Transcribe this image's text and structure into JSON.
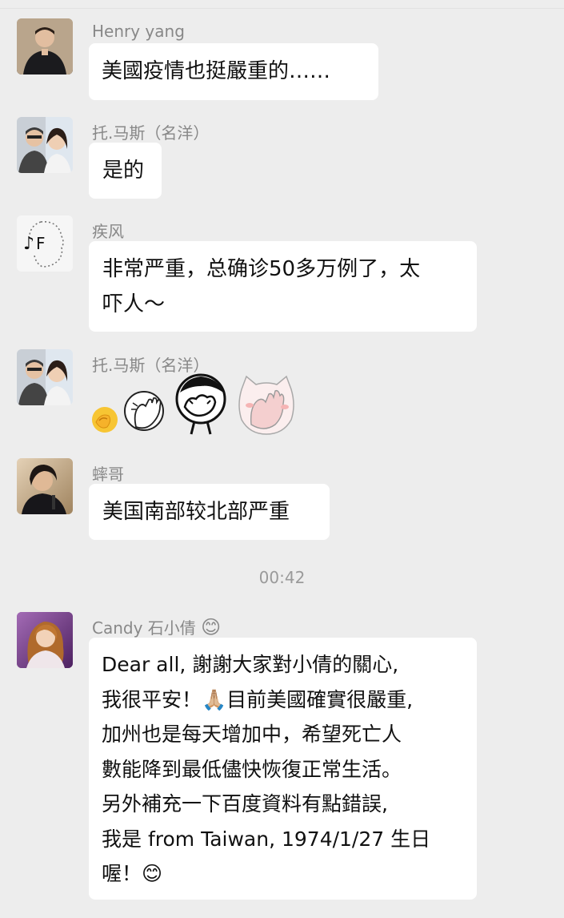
{
  "messages": [
    {
      "sender": "Henry yang",
      "text": "美國疫情也挺嚴重的……"
    },
    {
      "sender": "托.马斯（名洋）",
      "text": "是的"
    },
    {
      "sender": "疾风",
      "lines": [
        "非常严重，总确诊50多万例了，太",
        "吓人～"
      ]
    },
    {
      "sender": "托.马斯（名洋）",
      "stickers": [
        "facepalm-emoji",
        "facepalm-sticker-1",
        "facepalm-sticker-2",
        "facepalm-sticker-cat"
      ]
    },
    {
      "sender": "蟀哥",
      "text": "美国南部较北部严重"
    }
  ],
  "timestamp": "00:42",
  "candy": {
    "sender": "Candy 石小倩",
    "sender_emoji": "😊",
    "lines": [
      "Dear all, 謝謝大家對小倩的關心,",
      "我很平安！🙏🏼目前美國確實很嚴重,",
      "加州也是每天增加中，希望死亡人",
      "數能降到最低儘快恢復正常生活。",
      "另外補充一下百度資料有點錯誤,",
      "我是 from Taiwan, 1974/1/27 生日",
      "喔！😊"
    ]
  }
}
